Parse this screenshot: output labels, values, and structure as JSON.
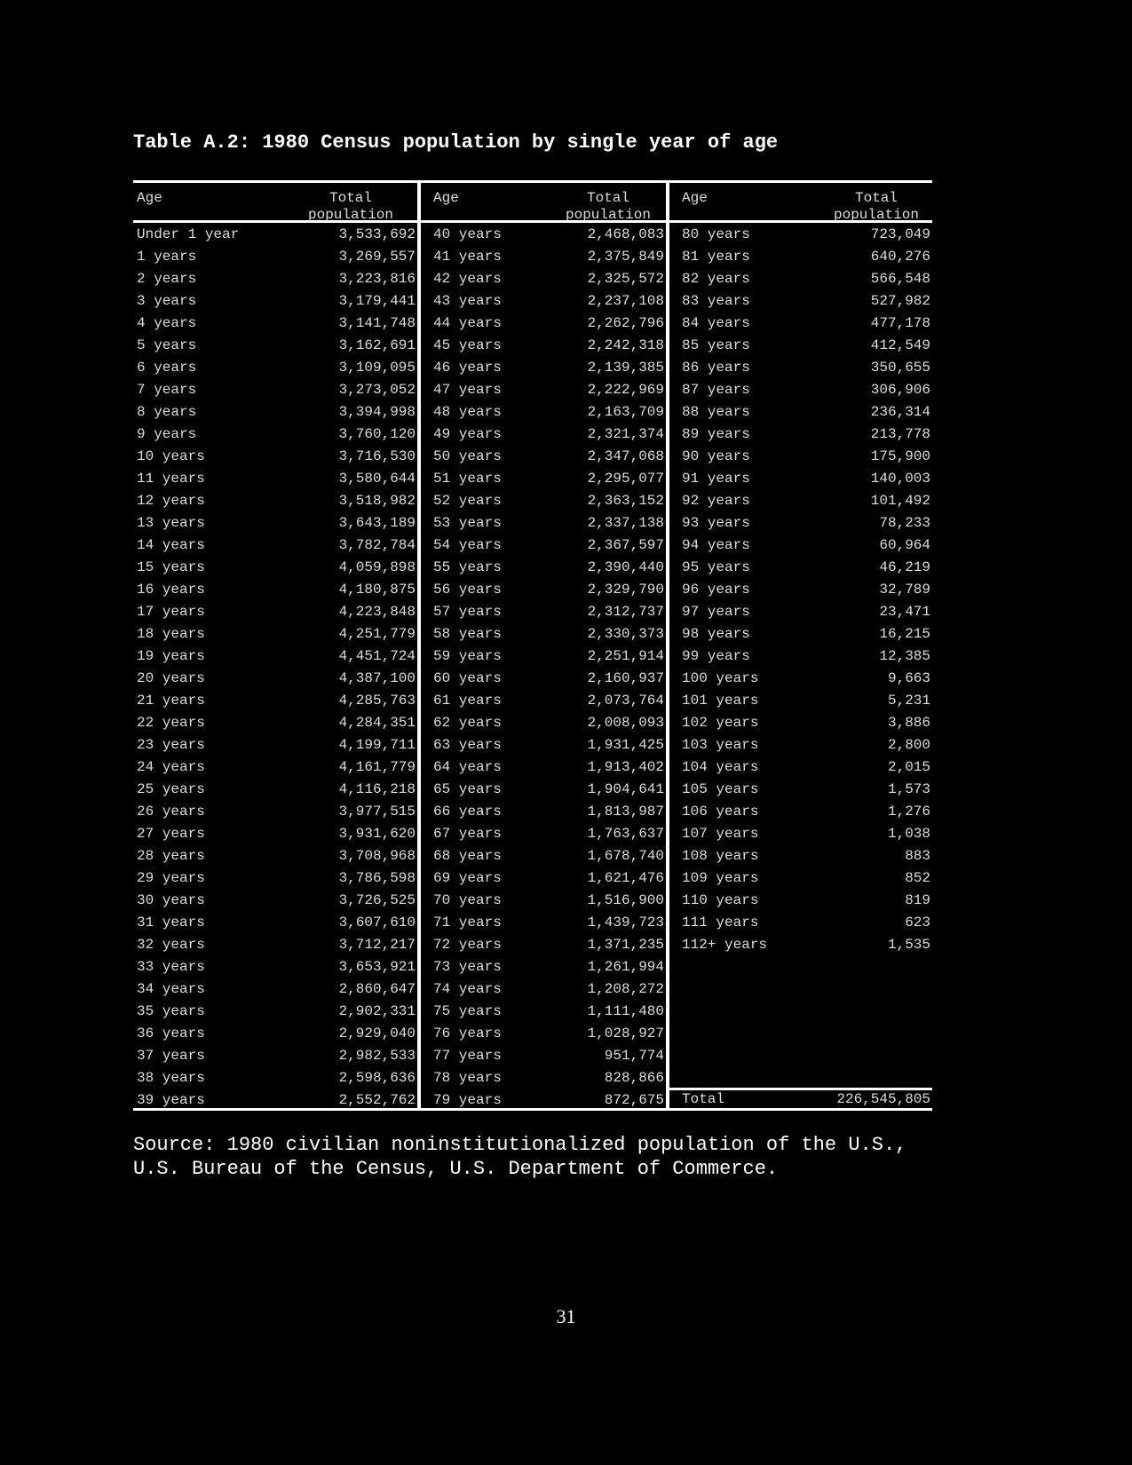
{
  "title": "Table A.2: 1980 Census population by single year of age",
  "header": {
    "age": "Age",
    "total_line1": "Total",
    "total_line2": "population"
  },
  "columns": [
    {
      "rows": [
        {
          "age": "Under 1 year",
          "total": "3,533,692"
        },
        {
          "age": "1 years",
          "total": "3,269,557"
        },
        {
          "age": "2 years",
          "total": "3,223,816"
        },
        {
          "age": "3 years",
          "total": "3,179,441"
        },
        {
          "age": "4 years",
          "total": "3,141,748"
        },
        {
          "age": "5 years",
          "total": "3,162,691"
        },
        {
          "age": "6 years",
          "total": "3,109,095"
        },
        {
          "age": "7 years",
          "total": "3,273,052"
        },
        {
          "age": "8 years",
          "total": "3,394,998"
        },
        {
          "age": "9 years",
          "total": "3,760,120"
        },
        {
          "age": "10 years",
          "total": "3,716,530"
        },
        {
          "age": "11 years",
          "total": "3,580,644"
        },
        {
          "age": "12 years",
          "total": "3,518,982"
        },
        {
          "age": "13 years",
          "total": "3,643,189"
        },
        {
          "age": "14 years",
          "total": "3,782,784"
        },
        {
          "age": "15 years",
          "total": "4,059,898"
        },
        {
          "age": "16 years",
          "total": "4,180,875"
        },
        {
          "age": "17 years",
          "total": "4,223,848"
        },
        {
          "age": "18 years",
          "total": "4,251,779"
        },
        {
          "age": "19 years",
          "total": "4,451,724"
        },
        {
          "age": "20 years",
          "total": "4,387,100"
        },
        {
          "age": "21 years",
          "total": "4,285,763"
        },
        {
          "age": "22 years",
          "total": "4,284,351"
        },
        {
          "age": "23 years",
          "total": "4,199,711"
        },
        {
          "age": "24 years",
          "total": "4,161,779"
        },
        {
          "age": "25 years",
          "total": "4,116,218"
        },
        {
          "age": "26 years",
          "total": "3,977,515"
        },
        {
          "age": "27 years",
          "total": "3,931,620"
        },
        {
          "age": "28 years",
          "total": "3,708,968"
        },
        {
          "age": "29 years",
          "total": "3,786,598"
        },
        {
          "age": "30 years",
          "total": "3,726,525"
        },
        {
          "age": "31 years",
          "total": "3,607,610"
        },
        {
          "age": "32 years",
          "total": "3,712,217"
        },
        {
          "age": "33 years",
          "total": "3,653,921"
        },
        {
          "age": "34 years",
          "total": "2,860,647"
        },
        {
          "age": "35 years",
          "total": "2,902,331"
        },
        {
          "age": "36 years",
          "total": "2,929,040"
        },
        {
          "age": "37 years",
          "total": "2,982,533"
        },
        {
          "age": "38 years",
          "total": "2,598,636"
        },
        {
          "age": "39 years",
          "total": "2,552,762"
        }
      ]
    },
    {
      "rows": [
        {
          "age": "40 years",
          "total": "2,468,083"
        },
        {
          "age": "41 years",
          "total": "2,375,849"
        },
        {
          "age": "42 years",
          "total": "2,325,572"
        },
        {
          "age": "43 years",
          "total": "2,237,108"
        },
        {
          "age": "44 years",
          "total": "2,262,796"
        },
        {
          "age": "45 years",
          "total": "2,242,318"
        },
        {
          "age": "46 years",
          "total": "2,139,385"
        },
        {
          "age": "47 years",
          "total": "2,222,969"
        },
        {
          "age": "48 years",
          "total": "2,163,709"
        },
        {
          "age": "49 years",
          "total": "2,321,374"
        },
        {
          "age": "50 years",
          "total": "2,347,068"
        },
        {
          "age": "51 years",
          "total": "2,295,077"
        },
        {
          "age": "52 years",
          "total": "2,363,152"
        },
        {
          "age": "53 years",
          "total": "2,337,138"
        },
        {
          "age": "54 years",
          "total": "2,367,597"
        },
        {
          "age": "55 years",
          "total": "2,390,440"
        },
        {
          "age": "56 years",
          "total": "2,329,790"
        },
        {
          "age": "57 years",
          "total": "2,312,737"
        },
        {
          "age": "58 years",
          "total": "2,330,373"
        },
        {
          "age": "59 years",
          "total": "2,251,914"
        },
        {
          "age": "60 years",
          "total": "2,160,937"
        },
        {
          "age": "61 years",
          "total": "2,073,764"
        },
        {
          "age": "62 years",
          "total": "2,008,093"
        },
        {
          "age": "63 years",
          "total": "1,931,425"
        },
        {
          "age": "64 years",
          "total": "1,913,402"
        },
        {
          "age": "65 years",
          "total": "1,904,641"
        },
        {
          "age": "66 years",
          "total": "1,813,987"
        },
        {
          "age": "67 years",
          "total": "1,763,637"
        },
        {
          "age": "68 years",
          "total": "1,678,740"
        },
        {
          "age": "69 years",
          "total": "1,621,476"
        },
        {
          "age": "70 years",
          "total": "1,516,900"
        },
        {
          "age": "71 years",
          "total": "1,439,723"
        },
        {
          "age": "72 years",
          "total": "1,371,235"
        },
        {
          "age": "73 years",
          "total": "1,261,994"
        },
        {
          "age": "74 years",
          "total": "1,208,272"
        },
        {
          "age": "75 years",
          "total": "1,111,480"
        },
        {
          "age": "76 years",
          "total": "1,028,927"
        },
        {
          "age": "77 years",
          "total": "951,774"
        },
        {
          "age": "78 years",
          "total": "828,866"
        },
        {
          "age": "79 years",
          "total": "872,675"
        }
      ]
    },
    {
      "rows": [
        {
          "age": "80 years",
          "total": "723,049"
        },
        {
          "age": "81 years",
          "total": "640,276"
        },
        {
          "age": "82 years",
          "total": "566,548"
        },
        {
          "age": "83 years",
          "total": "527,982"
        },
        {
          "age": "84 years",
          "total": "477,178"
        },
        {
          "age": "85 years",
          "total": "412,549"
        },
        {
          "age": "86 years",
          "total": "350,655"
        },
        {
          "age": "87 years",
          "total": "306,906"
        },
        {
          "age": "88 years",
          "total": "236,314"
        },
        {
          "age": "89 years",
          "total": "213,778"
        },
        {
          "age": "90 years",
          "total": "175,900"
        },
        {
          "age": "91 years",
          "total": "140,003"
        },
        {
          "age": "92 years",
          "total": "101,492"
        },
        {
          "age": "93 years",
          "total": "78,233"
        },
        {
          "age": "94 years",
          "total": "60,964"
        },
        {
          "age": "95 years",
          "total": "46,219"
        },
        {
          "age": "96 years",
          "total": "32,789"
        },
        {
          "age": "97 years",
          "total": "23,471"
        },
        {
          "age": "98 years",
          "total": "16,215"
        },
        {
          "age": "99 years",
          "total": "12,385"
        },
        {
          "age": "100 years",
          "total": "9,663"
        },
        {
          "age": "101 years",
          "total": "5,231"
        },
        {
          "age": "102 years",
          "total": "3,886"
        },
        {
          "age": "103 years",
          "total": "2,800"
        },
        {
          "age": "104 years",
          "total": "2,015"
        },
        {
          "age": "105 years",
          "total": "1,573"
        },
        {
          "age": "106 years",
          "total": "1,276"
        },
        {
          "age": "107 years",
          "total": "1,038"
        },
        {
          "age": "108 years",
          "total": "883"
        },
        {
          "age": "109 years",
          "total": "852"
        },
        {
          "age": "110 years",
          "total": "819"
        },
        {
          "age": "111 years",
          "total": "623"
        },
        {
          "age": "112+ years",
          "total": "1,535"
        }
      ]
    }
  ],
  "total": {
    "label": "Total",
    "value": "226,545,805"
  },
  "source_line1": "Source: 1980 civilian noninstitutionalized population of the U.S.,",
  "source_line2": "U.S. Bureau of the Census, U.S. Department of Commerce.",
  "page_number": "31"
}
